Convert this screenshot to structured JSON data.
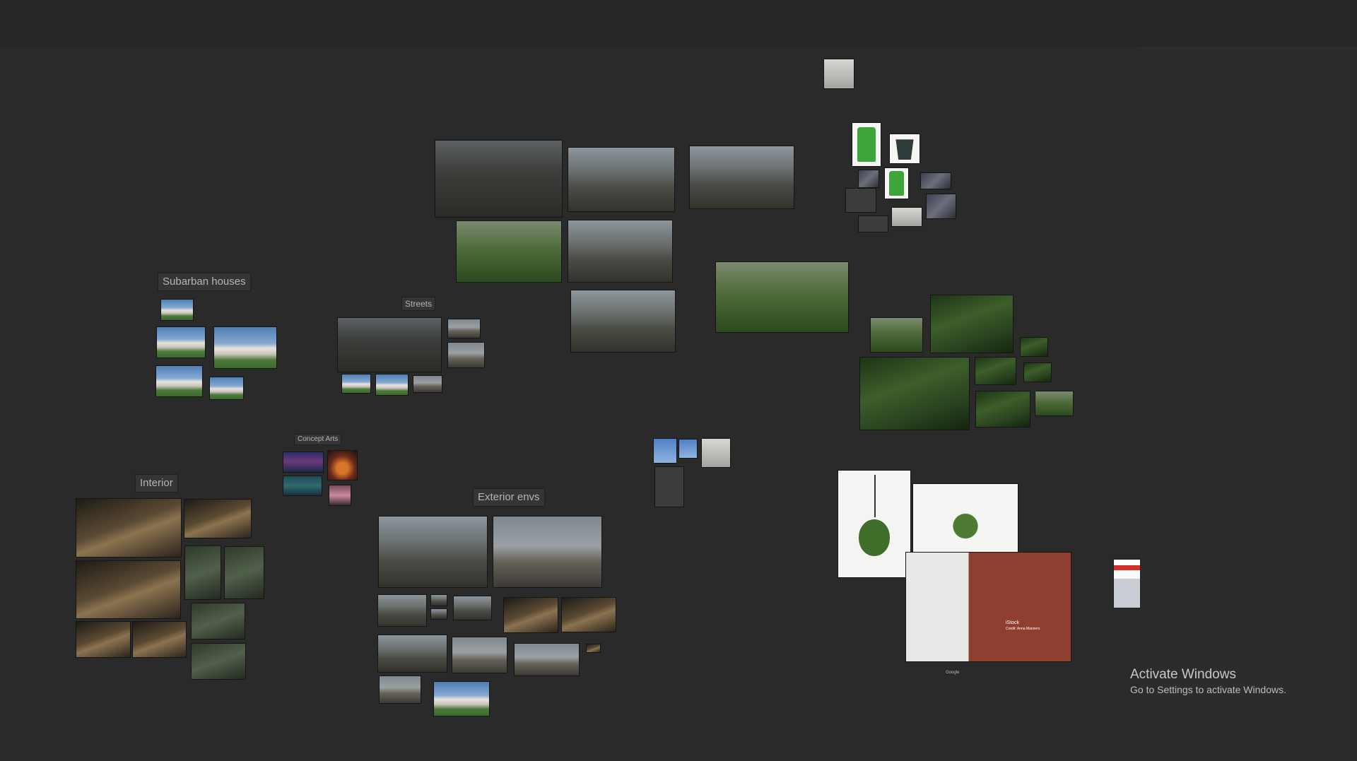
{
  "app": {
    "colors": {
      "canvas": "#2a2a2a",
      "topbar": "#262626",
      "label_background": "#353535",
      "label_text": "#b5b5b5"
    }
  },
  "board": {
    "groups": [
      {
        "id": "subarban-houses",
        "label": "Subarban houses"
      },
      {
        "id": "streets",
        "label": "Streets"
      },
      {
        "id": "concept-arts",
        "label": "Concept Arts"
      },
      {
        "id": "interior",
        "label": "Interior"
      },
      {
        "id": "exterior-envs",
        "label": "Exterior envs"
      }
    ],
    "image_captions": {
      "istock_title": "iStock",
      "istock_credit": "Credit: Anna Manners",
      "google_small": "Google"
    }
  },
  "watermark": {
    "title": "Activate Windows",
    "subtitle": "Go to Settings to activate Windows."
  }
}
